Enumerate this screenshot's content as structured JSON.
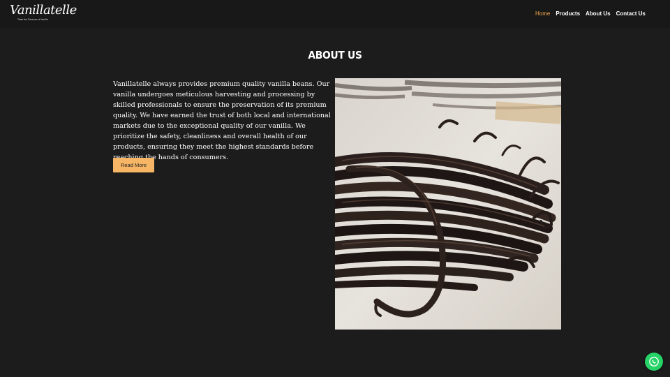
{
  "brand": {
    "name": "Vanillatelle",
    "tagline": "Taste the Essence of Vanilla"
  },
  "nav": {
    "items": [
      {
        "label": "Home",
        "active": true
      },
      {
        "label": "Products",
        "active": false
      },
      {
        "label": "About Us",
        "active": false
      },
      {
        "label": "Contact Us",
        "active": false
      }
    ]
  },
  "about": {
    "title": "ABOUT US",
    "body": "Vanillatelle always provides premium quality vanilla beans. Our vanilla undergoes meticulous harvesting and processing by skilled professionals to ensure the preservation of its premium quality. We have earned the trust of both local and international markets due to the exceptional quality of our vanilla. We prioritize the safety, cleanliness and overall health of our products, ensuring they meet the highest standards before reaching the hands of consumers.",
    "button_label": "Read More"
  },
  "floating": {
    "icon": "whatsapp-icon"
  },
  "colors": {
    "background": "#1c1c1c",
    "navbar": "#181818",
    "accent": "#f3a94a",
    "button": "#f7b666",
    "whatsapp": "#25d366"
  }
}
